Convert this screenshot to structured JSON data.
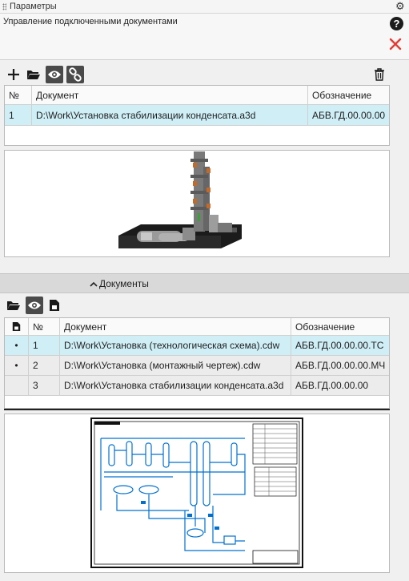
{
  "window": {
    "title": "Параметры"
  },
  "header": {
    "subtitle": "Управление подключенными документами"
  },
  "top_table": {
    "columns": [
      "№",
      "Документ",
      "Обозначение"
    ],
    "rows": [
      {
        "num": "1",
        "doc": "D:\\Work\\Установка стабилизации конденсата.a3d",
        "code": "АБВ.ГД.00.00.00"
      }
    ]
  },
  "splitter": {
    "label": "Документы"
  },
  "bottom_table": {
    "columns": [
      "№",
      "Документ",
      "Обозначение"
    ],
    "rows": [
      {
        "mark": "•",
        "num": "1",
        "doc": "D:\\Work\\Установка (технологическая схема).cdw",
        "code": "АБВ.ГД.00.00.00.ТС"
      },
      {
        "mark": "•",
        "num": "2",
        "doc": "D:\\Work\\Установка (монтажный чертеж).cdw",
        "code": "АБВ.ГД.00.00.00.МЧ"
      },
      {
        "mark": "",
        "num": "3",
        "doc": "D:\\Work\\Установка стабилизации конденсата.a3d",
        "code": "АБВ.ГД.00.00.00"
      }
    ]
  },
  "colors": {
    "selection": "#cfeef6",
    "close": "#e53935",
    "toolbar_active": "#4a4a4a"
  }
}
